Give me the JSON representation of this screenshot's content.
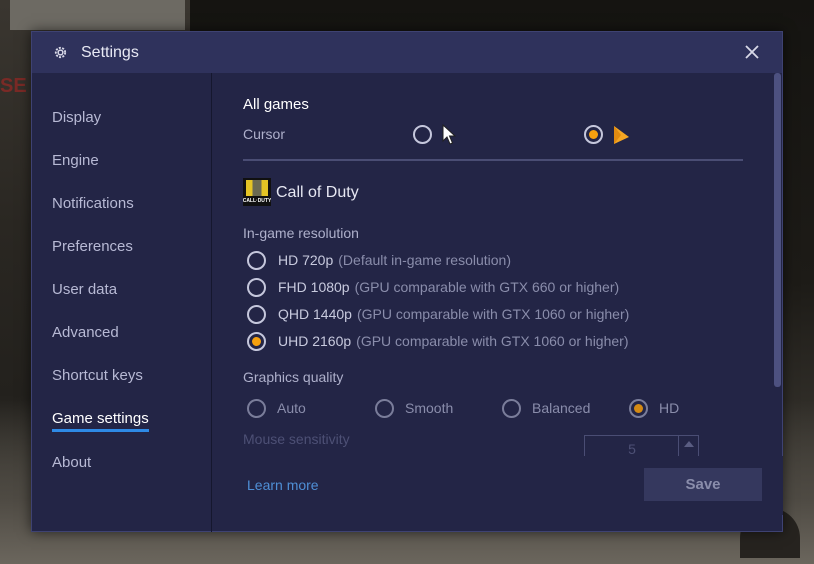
{
  "window": {
    "title": "Settings",
    "icon": "gear-icon",
    "close_icon": "close-icon"
  },
  "sidebar": {
    "items": [
      {
        "label": "Display",
        "active": false
      },
      {
        "label": "Engine",
        "active": false
      },
      {
        "label": "Notifications",
        "active": false
      },
      {
        "label": "Preferences",
        "active": false
      },
      {
        "label": "User data",
        "active": false
      },
      {
        "label": "Advanced",
        "active": false
      },
      {
        "label": "Shortcut keys",
        "active": false
      },
      {
        "label": "Game settings",
        "active": true
      },
      {
        "label": "About",
        "active": false
      }
    ],
    "active_underline_color": "#2e8ae6"
  },
  "all_games": {
    "title": "All games",
    "cursor_label": "Cursor",
    "cursor_options": [
      {
        "name": "default-white-cursor",
        "selected": false,
        "color": "#ffffff"
      },
      {
        "name": "orange-cursor",
        "selected": true,
        "color": "#f5a623"
      }
    ]
  },
  "game": {
    "name": "Call of Duty",
    "icon_text": "CALL·DUTY",
    "resolution": {
      "label": "In-game resolution",
      "options": [
        {
          "name": "HD 720p",
          "desc": "(Default in-game resolution)",
          "selected": false
        },
        {
          "name": "FHD 1080p",
          "desc": "(GPU comparable with GTX 660 or higher)",
          "selected": false
        },
        {
          "name": "QHD 1440p",
          "desc": "(GPU comparable with GTX 1060 or higher)",
          "selected": false
        },
        {
          "name": "UHD 2160p",
          "desc": "(GPU comparable with GTX 1060 or higher)",
          "selected": true
        }
      ]
    },
    "graphics_quality": {
      "label": "Graphics quality",
      "options": [
        {
          "label": "Auto",
          "selected": false
        },
        {
          "label": "Smooth",
          "selected": false
        },
        {
          "label": "Balanced",
          "selected": false
        },
        {
          "label": "HD",
          "selected": true
        }
      ]
    },
    "mouse_sensitivity": {
      "label": "Mouse sensitivity",
      "value": "5"
    }
  },
  "footer": {
    "learn_more": "Learn more",
    "save": "Save"
  },
  "colors": {
    "accent_orange": "#f5a00f",
    "link_blue": "#4f8fd6",
    "dialog_bg": "#232546",
    "titlebar_bg": "#2f325c"
  }
}
